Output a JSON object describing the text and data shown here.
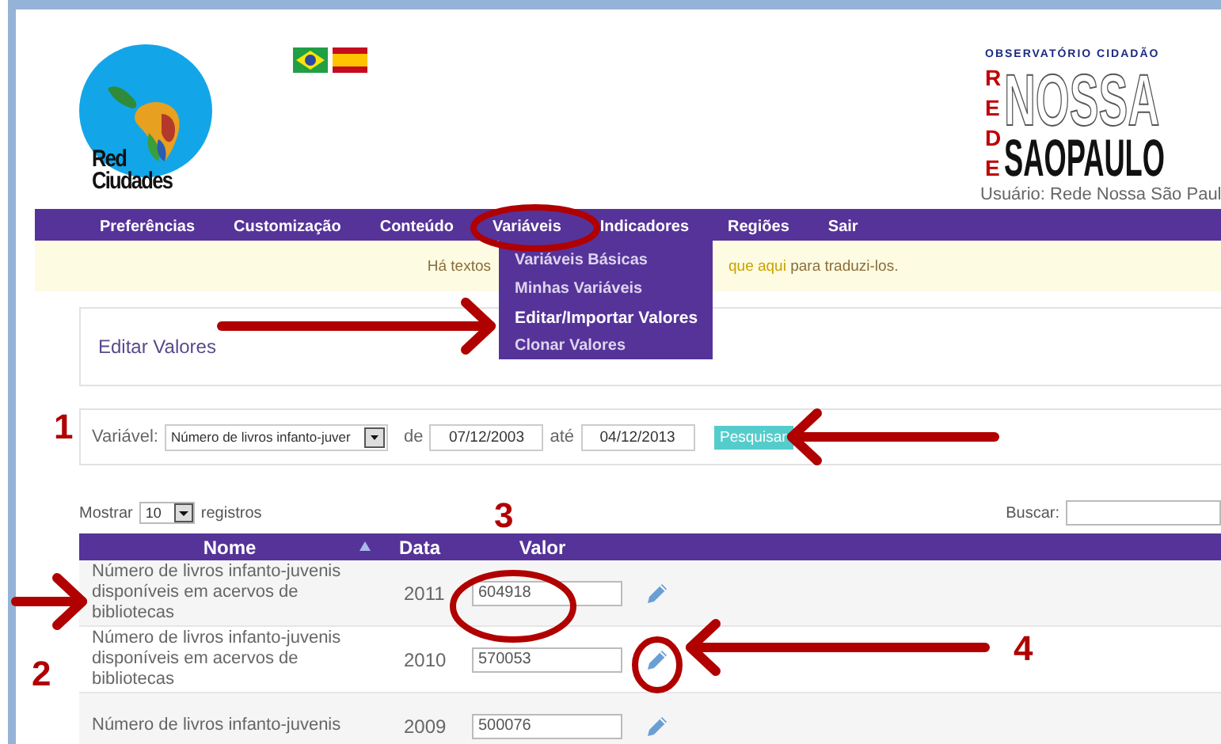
{
  "header": {
    "logo_text": "Red Ciudades",
    "partner_logo": {
      "top": "OBSERVATÓRIO CIDADÃO",
      "vertical": "REDE",
      "line1": "NOSSA",
      "line2": "SAOPAULO"
    },
    "user": "Usuário: Rede Nossa São Paul"
  },
  "nav": [
    {
      "label": "Preferências"
    },
    {
      "label": "Customização"
    },
    {
      "label": "Conteúdo"
    },
    {
      "label": "Variáveis",
      "menu": [
        {
          "label": "Variáveis Básicas",
          "selected": false
        },
        {
          "label": "Minhas Variáveis",
          "selected": false
        },
        {
          "label": "Editar/Importar Valores",
          "selected": true
        },
        {
          "label": "Clonar Valores",
          "selected": false
        }
      ]
    },
    {
      "label": "Indicadores"
    },
    {
      "label": "Regiões"
    },
    {
      "label": "Sair"
    }
  ],
  "notice": {
    "before": "Há textos",
    "link": "que aqui",
    "after": "para traduzi-los."
  },
  "page_title": "Editar Valores",
  "filter": {
    "variable_label": "Variável:",
    "variable_value": "Número de livros infanto-juver",
    "from_label": "de",
    "from": "07/12/2003",
    "to_label": "até",
    "to": "04/12/2013",
    "button": "Pesquisar"
  },
  "table_controls": {
    "show_label": "Mostrar",
    "page_size": "10",
    "records_label": "registros",
    "search_label": "Buscar:"
  },
  "table": {
    "columns": [
      "Nome",
      "Data",
      "Valor"
    ],
    "rows": [
      {
        "name": "Número de livros infanto-juvenis disponíveis em acervos de bibliotecas",
        "date": "2011",
        "value": "604918"
      },
      {
        "name": "Número de livros infanto-juvenis disponíveis em acervos de bibliotecas",
        "date": "2010",
        "value": "570053"
      },
      {
        "name": "Número de livros infanto-juvenis",
        "date": "2009",
        "value": "500076"
      }
    ]
  },
  "annotations": [
    {
      "kind": "ellipse"
    },
    {
      "kind": "arrow"
    },
    {
      "kind": "number",
      "label": "1"
    },
    {
      "kind": "arrow"
    },
    {
      "kind": "number",
      "label": "3"
    },
    {
      "kind": "ellipse"
    },
    {
      "kind": "arrow"
    },
    {
      "kind": "number",
      "label": "2"
    },
    {
      "kind": "ellipse"
    },
    {
      "kind": "arrow"
    },
    {
      "kind": "number",
      "label": "4"
    }
  ]
}
